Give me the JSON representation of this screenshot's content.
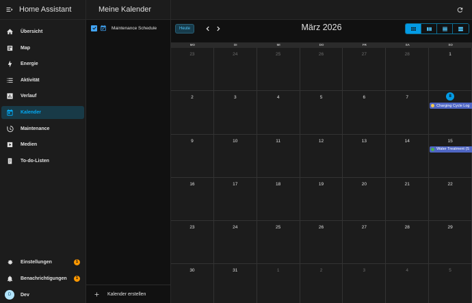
{
  "app": {
    "title": "Home Assistant"
  },
  "sidebar": {
    "items": [
      {
        "label": "Übersicht",
        "icon": "dashboard-icon"
      },
      {
        "label": "Map",
        "icon": "map-icon"
      },
      {
        "label": "Energie",
        "icon": "lightning-icon"
      },
      {
        "label": "Aktivität",
        "icon": "list-icon"
      },
      {
        "label": "Verlauf",
        "icon": "chart-icon"
      },
      {
        "label": "Kalender",
        "icon": "calendar-icon",
        "active": true
      },
      {
        "label": "Maintenance",
        "icon": "clock-history-icon"
      },
      {
        "label": "Medien",
        "icon": "play-box-icon"
      },
      {
        "label": "To-do-Listen",
        "icon": "clipboard-icon"
      }
    ],
    "settings_label": "Einstellungen",
    "settings_badge": "1",
    "notifications_label": "Benachrichtigungen",
    "notifications_badge": "1",
    "user_initial": "D",
    "user_name": "Dev"
  },
  "calendars": {
    "title": "Meine Kalender",
    "items": [
      {
        "label": "Maintenance Schedule",
        "checked": true
      }
    ],
    "create_label": "Kalender erstellen"
  },
  "main": {
    "today_label": "Heute",
    "month_title": "März 2026",
    "weekdays": [
      "MO",
      "DI",
      "MI",
      "DO",
      "FR",
      "SA",
      "SO"
    ],
    "weeks": [
      [
        "23",
        "24",
        "25",
        "26",
        "27",
        "28",
        "1"
      ],
      [
        "2",
        "3",
        "4",
        "5",
        "6",
        "7",
        "8"
      ],
      [
        "9",
        "10",
        "11",
        "12",
        "13",
        "14",
        "15"
      ],
      [
        "16",
        "17",
        "18",
        "19",
        "20",
        "21",
        "22"
      ],
      [
        "23",
        "24",
        "25",
        "26",
        "27",
        "28",
        "29"
      ],
      [
        "30",
        "31",
        "1",
        "2",
        "3",
        "4",
        "5"
      ]
    ],
    "events": [
      {
        "label": "Charging Cycle Log",
        "dot_color": "#f2c94c"
      },
      {
        "label": "Water Treatment (S",
        "dot_color": "#4caf50"
      }
    ]
  },
  "colors": {
    "accent": "#03a9f4",
    "event_bg": "#4f66c4",
    "badge": "#ff9800"
  }
}
